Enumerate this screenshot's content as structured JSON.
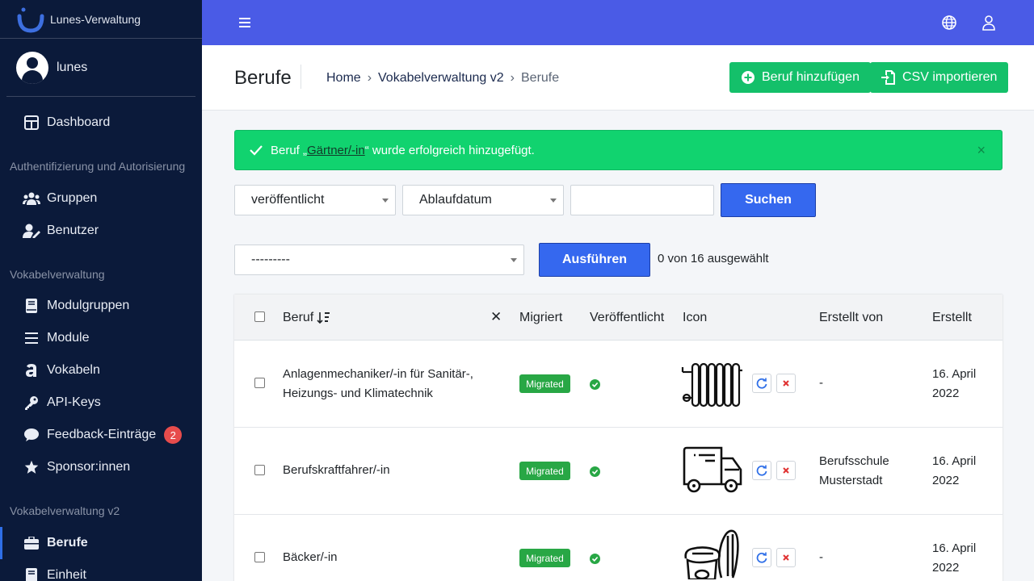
{
  "app": {
    "title": "Lunes-Verwaltung"
  },
  "user": {
    "name": "lunes"
  },
  "sidebar": {
    "dashboard": "Dashboard",
    "section_auth": "Authentifizierung und Autorisierung",
    "groups": "Gruppen",
    "users": "Benutzer",
    "section_vocab": "Vokabelverwaltung",
    "module_groups": "Modulgruppen",
    "modules": "Module",
    "vocabulary": "Vokabeln",
    "api_keys": "API-Keys",
    "feedback": "Feedback-Einträge",
    "feedback_count": "2",
    "sponsors": "Sponsor:innen",
    "section_vocab_v2": "Vokabelverwaltung v2",
    "jobs": "Berufe",
    "unit": "Einheit"
  },
  "header": {
    "title": "Berufe",
    "breadcrumb": {
      "home": "Home",
      "section": "Vokabelverwaltung v2",
      "current": "Berufe",
      "sep": "›"
    },
    "add_button": "Beruf hinzufügen",
    "import_button": "CSV importieren"
  },
  "alert": {
    "prefix": "Beruf „",
    "link": "Gärtner/-in",
    "suffix": "“ wurde erfolgreich hinzugefügt.",
    "close": "×"
  },
  "filters": {
    "published": "veröffentlicht",
    "expiry": "Ablaufdatum",
    "search_value": "",
    "search_button": "Suchen"
  },
  "actions": {
    "select_value": "---------",
    "run_button": "Ausführen",
    "selection_count": "0 von 16 ausgewählt"
  },
  "table": {
    "headers": {
      "job": "Beruf",
      "clear": "✕",
      "migrated": "Migriert",
      "published": "Veröffentlicht",
      "icon": "Icon",
      "created_by": "Erstellt von",
      "created": "Erstellt"
    },
    "rows": [
      {
        "name_line1": "Anlagenmechaniker/-in für Sanitär-,",
        "name_line2": "Heizungs- und Klimatechnik",
        "migrated": "Migrated",
        "icon": "radiator-icon",
        "created_by_line1": "-",
        "created_by_line2": "",
        "created_line1": "16. April",
        "created_line2": "2022"
      },
      {
        "name_line1": "Berufskraftfahrer/-in",
        "name_line2": "",
        "migrated": "Migrated",
        "icon": "truck-icon",
        "created_by_line1": "Berufsschule",
        "created_by_line2": "Musterstadt",
        "created_line1": "16. April",
        "created_line2": "2022"
      },
      {
        "name_line1": "Bäcker/-in",
        "name_line2": "",
        "migrated": "Migrated",
        "icon": "bread-icon",
        "created_by_line1": "-",
        "created_by_line2": "",
        "created_line1": "16. April",
        "created_line2": "2022"
      }
    ]
  },
  "colors": {
    "sidebar_bg": "#0b1a3a",
    "topbar_bg": "#4a5be6",
    "success": "#11d36f",
    "primary": "#3568ef",
    "badge_green": "#28a745",
    "badge_red": "#e74c4c"
  }
}
